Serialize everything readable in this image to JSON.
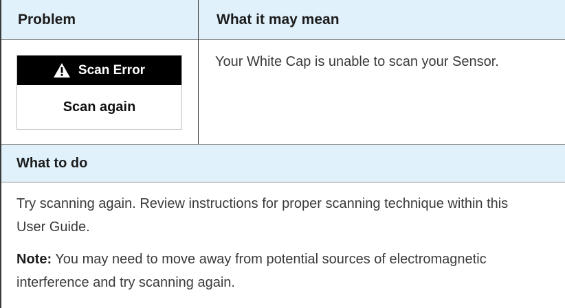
{
  "table": {
    "headers": {
      "problem": "Problem",
      "meaning": "What it may mean"
    },
    "error_screen": {
      "icon": "warning-triangle-icon",
      "title": "Scan Error",
      "action": "Scan again"
    },
    "meaning_text": "Your White Cap is unable to scan your Sensor.",
    "todo_label": "What to do",
    "todo_text": "Try scanning again. Review instructions for proper scanning technique within this User Guide.",
    "note_label": "Note:",
    "note_text": " You may need to move away from potential sources of electromagnetic interference and try scanning again."
  },
  "colors": {
    "header_background": "#e0f1fb",
    "rule": "#3a3a3a",
    "error_bar": "#000000"
  }
}
